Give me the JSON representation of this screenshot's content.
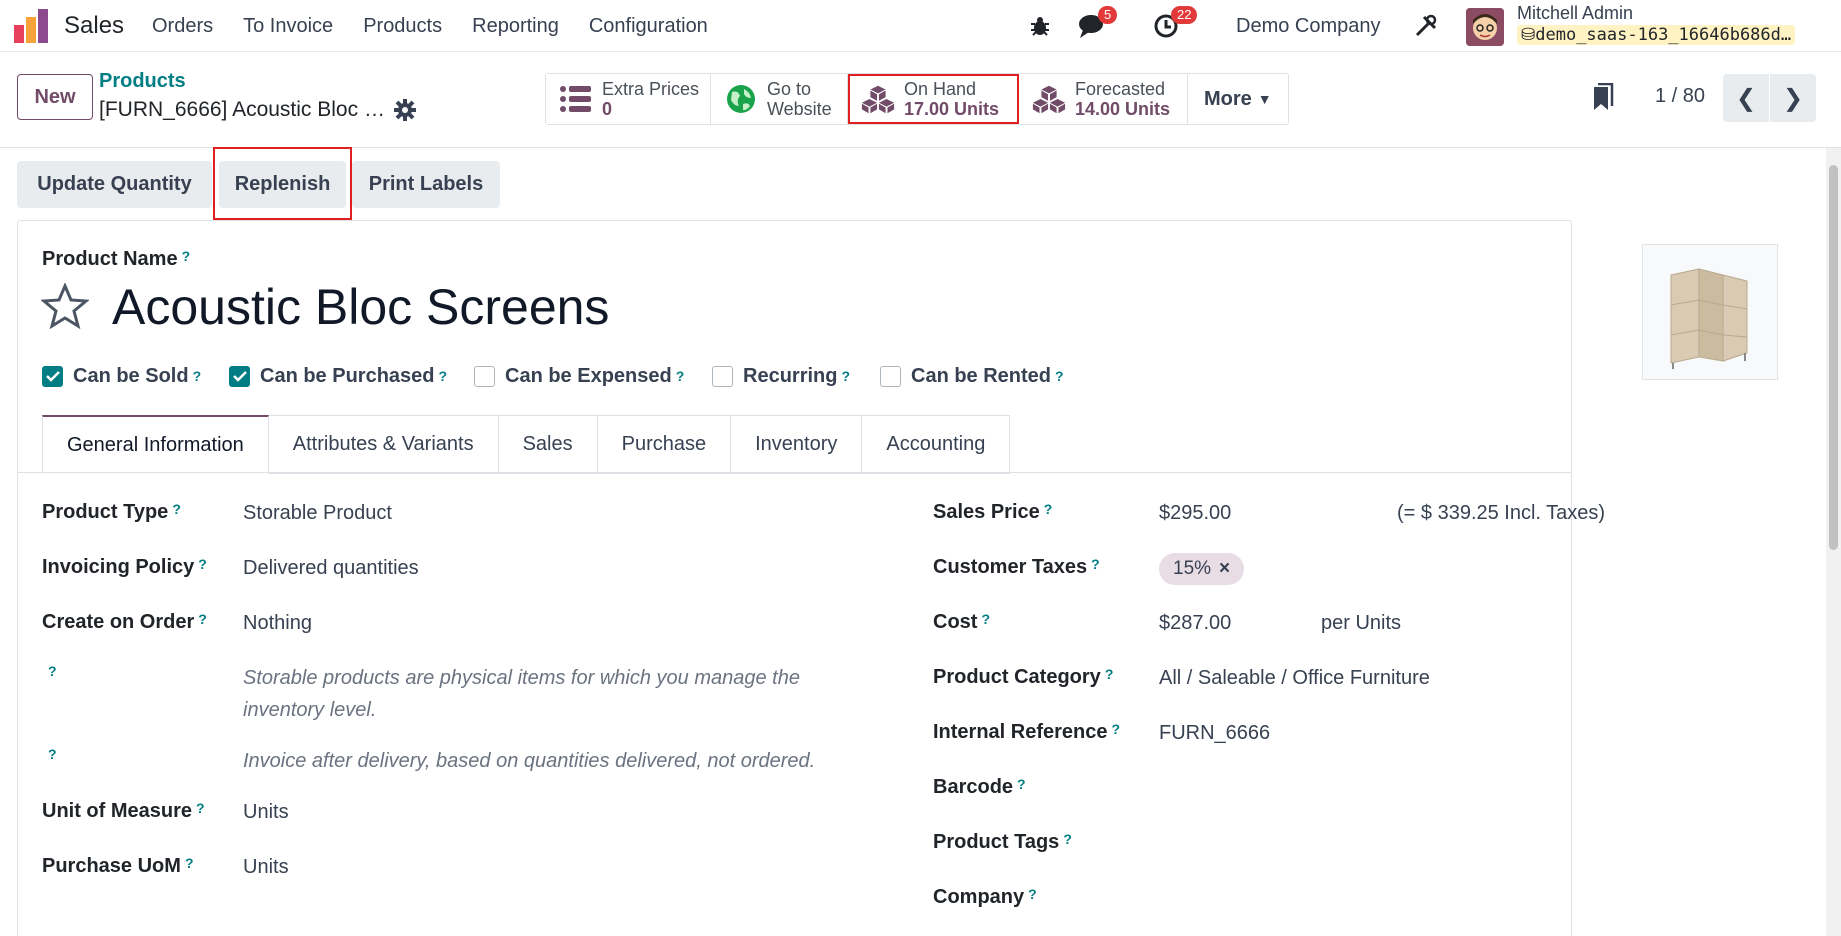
{
  "topbar": {
    "app_name": "Sales",
    "menu": [
      "Orders",
      "To Invoice",
      "Products",
      "Reporting",
      "Configuration"
    ],
    "messages_count": "5",
    "activities_count": "22",
    "company": "Demo Company",
    "user_name": "Mitchell Admin",
    "db_name": "demo_saas-163_16646b686d…"
  },
  "control": {
    "new_label": "New",
    "breadcrumb": "Products",
    "record_title": "[FURN_6666] Acoustic Bloc …",
    "stats": [
      {
        "label": "Extra Prices",
        "value": "0"
      },
      {
        "label": "Go to",
        "value": "Website"
      },
      {
        "label": "On Hand",
        "value": "17.00 Units"
      },
      {
        "label": "Forecasted",
        "value": "14.00 Units"
      }
    ],
    "more_label": "More",
    "pager": "1 / 80"
  },
  "actions": {
    "update_quantity": "Update Quantity",
    "replenish": "Replenish",
    "print_labels": "Print Labels"
  },
  "product": {
    "name_label": "Product Name",
    "name": "Acoustic Bloc Screens",
    "checkboxes": [
      {
        "label": "Can be Sold",
        "checked": true
      },
      {
        "label": "Can be Purchased",
        "checked": true
      },
      {
        "label": "Can be Expensed",
        "checked": false
      },
      {
        "label": "Recurring",
        "checked": false
      },
      {
        "label": "Can be Rented",
        "checked": false
      }
    ]
  },
  "tabs": [
    "General Information",
    "Attributes & Variants",
    "Sales",
    "Purchase",
    "Inventory",
    "Accounting"
  ],
  "left_fields": {
    "product_type_label": "Product Type",
    "product_type": "Storable Product",
    "invoicing_policy_label": "Invoicing Policy",
    "invoicing_policy": "Delivered quantities",
    "create_on_order_label": "Create on Order",
    "create_on_order": "Nothing",
    "help_storable": "Storable products are physical items for which you manage the inventory level.",
    "help_invoice": "Invoice after delivery, based on quantities delivered, not ordered.",
    "uom_label": "Unit of Measure",
    "uom": "Units",
    "purchase_uom_label": "Purchase UoM",
    "purchase_uom": "Units"
  },
  "right_fields": {
    "sales_price_label": "Sales Price",
    "sales_price": "$295.00",
    "incl_taxes": "(= $ 339.25 Incl. Taxes)",
    "customer_taxes_label": "Customer Taxes",
    "customer_tax_tag": "15%",
    "cost_label": "Cost",
    "cost": "$287.00",
    "cost_unit": "per Units",
    "category_label": "Product Category",
    "category": "All / Saleable / Office Furniture",
    "internal_ref_label": "Internal Reference",
    "internal_ref": "FURN_6666",
    "barcode_label": "Barcode",
    "tags_label": "Product Tags",
    "company_label": "Company"
  },
  "help_mark": "?",
  "colors": {
    "brand": "#714b67",
    "accent": "#017e84",
    "highlight": "#e02020"
  }
}
